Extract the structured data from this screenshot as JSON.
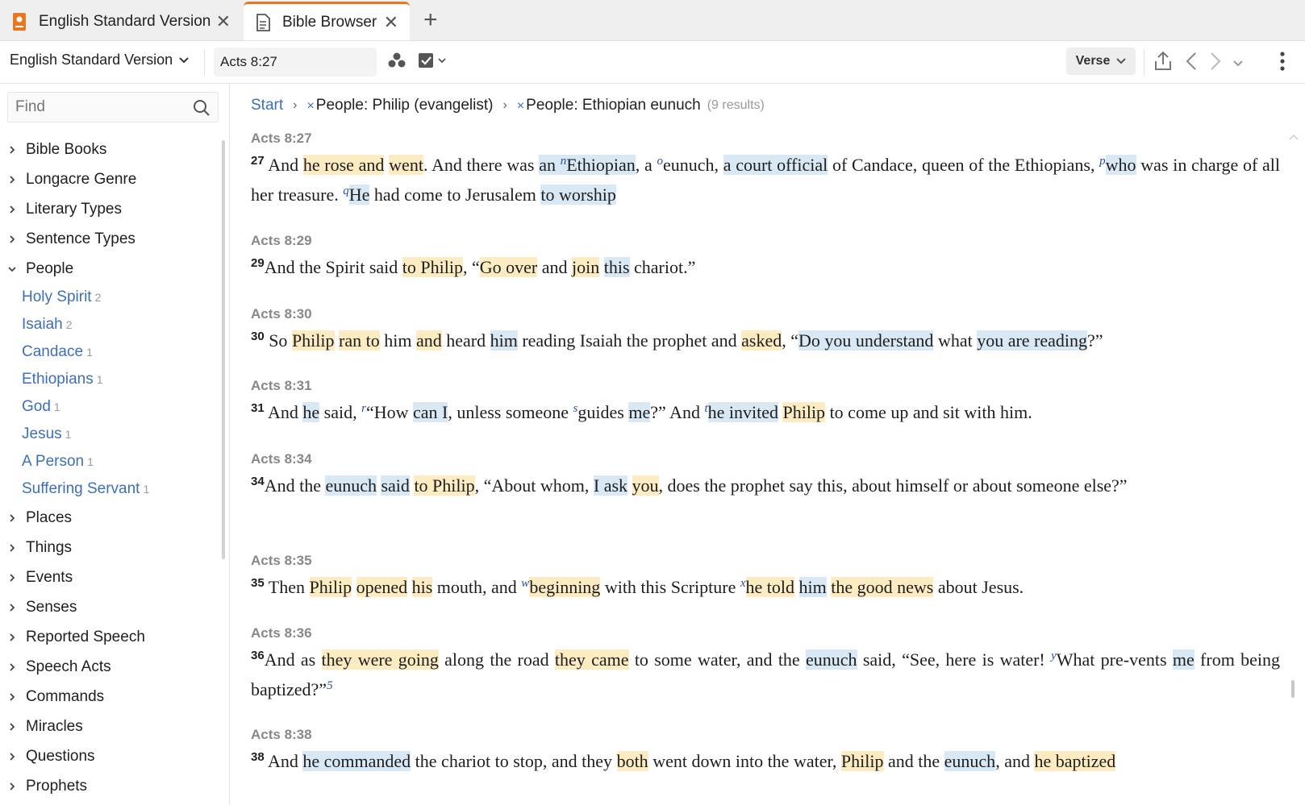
{
  "tabs": [
    {
      "label": "English Standard Version",
      "icon": "book-icon"
    },
    {
      "label": "Bible Browser",
      "icon": "document-icon"
    }
  ],
  "toolbar": {
    "version": "English Standard Version",
    "reference": "Acts 8:27",
    "view_mode": "Verse"
  },
  "sidebar": {
    "find_placeholder": "Find",
    "top": [
      "Bible Books",
      "Longacre Genre",
      "Literary Types",
      "Sentence Types"
    ],
    "people_label": "People",
    "people": [
      {
        "name": "Holy Spirit",
        "count": "2"
      },
      {
        "name": "Isaiah",
        "count": "2"
      },
      {
        "name": "Candace",
        "count": "1"
      },
      {
        "name": "Ethiopians",
        "count": "1"
      },
      {
        "name": "God",
        "count": "1"
      },
      {
        "name": "Jesus",
        "count": "1"
      },
      {
        "name": "A Person",
        "count": "1"
      },
      {
        "name": "Suffering Servant",
        "count": "1"
      }
    ],
    "bottom": [
      "Places",
      "Things",
      "Events",
      "Senses",
      "Reported Speech",
      "Speech Acts",
      "Commands",
      "Miracles",
      "Questions",
      "Prophets"
    ]
  },
  "breadcrumb": {
    "start": "Start",
    "filter1": "People: Philip (evangelist)",
    "filter2": "People: Ethiopian eunuch",
    "results": "(9 results)"
  },
  "verses": [
    {
      "ref": "Acts 8:27",
      "num": "27"
    },
    {
      "ref": "Acts 8:29",
      "num": "29"
    },
    {
      "ref": "Acts 8:30",
      "num": "30"
    },
    {
      "ref": "Acts 8:31",
      "num": "31"
    },
    {
      "ref": "Acts 8:34",
      "num": "34"
    },
    {
      "ref": "Acts 8:35",
      "num": "35"
    },
    {
      "ref": "Acts 8:36",
      "num": "36"
    },
    {
      "ref": "Acts 8:38",
      "num": "38"
    }
  ],
  "colors": {
    "accent": "#e87722",
    "link": "#3d6fb8",
    "highlight_person_philip": "#fdebc2",
    "highlight_person_eunuch": "#d9e8f5"
  }
}
